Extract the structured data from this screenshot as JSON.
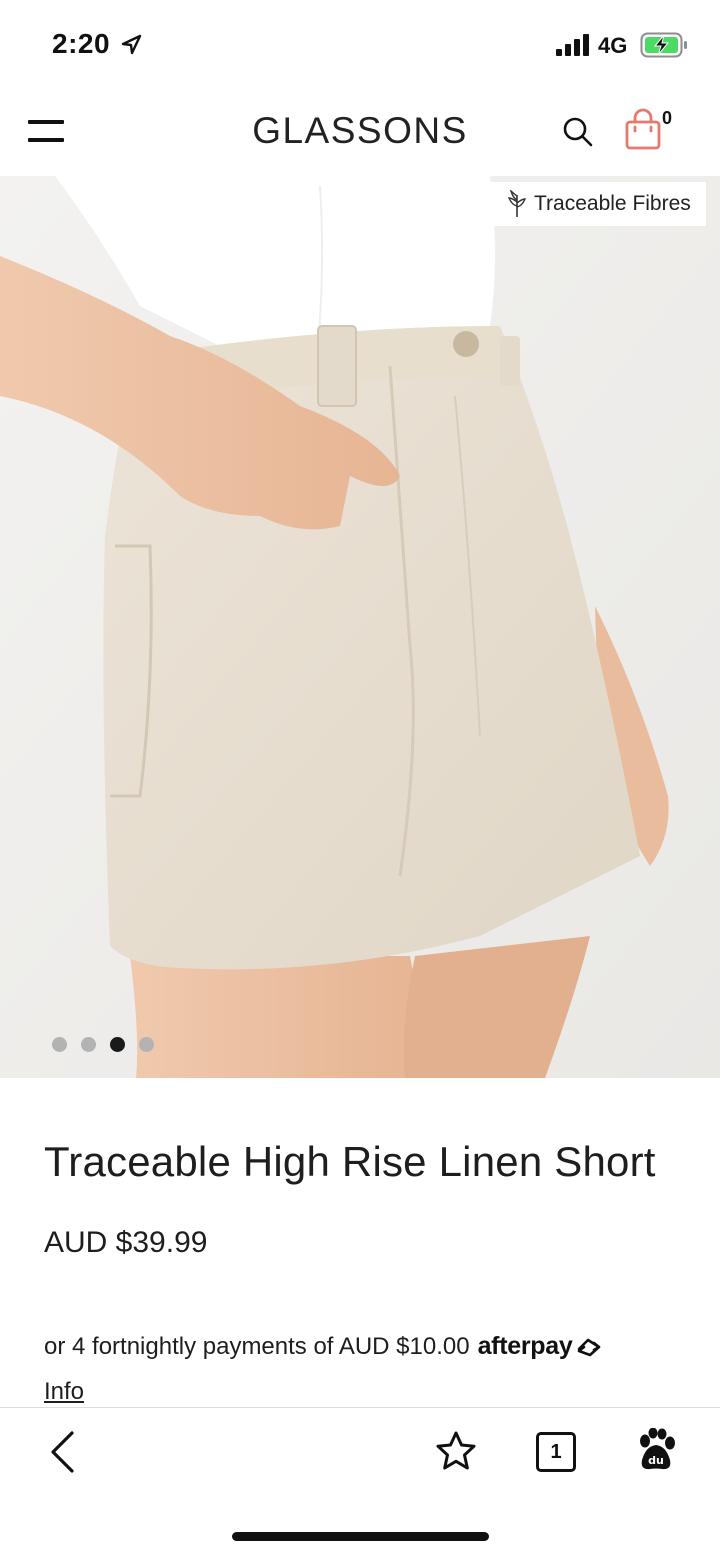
{
  "status_bar": {
    "time": "2:20",
    "network": "4G"
  },
  "header": {
    "brand": "GLASSONS",
    "cart_count": "0"
  },
  "gallery": {
    "badge_label": "Traceable Fibres",
    "slide_count": 4,
    "active_slide": 3
  },
  "product": {
    "title": "Traceable High Rise Linen Short",
    "price": "AUD $39.99",
    "installment_text": "or 4 fortnightly payments of AUD $10.00",
    "installment_provider": "afterpay",
    "info_link": "Info"
  },
  "browser": {
    "tab_count": "1"
  },
  "colors": {
    "cart_accent": "#e8786f",
    "linen": "#e6ddd0",
    "background": "#efeeec"
  }
}
